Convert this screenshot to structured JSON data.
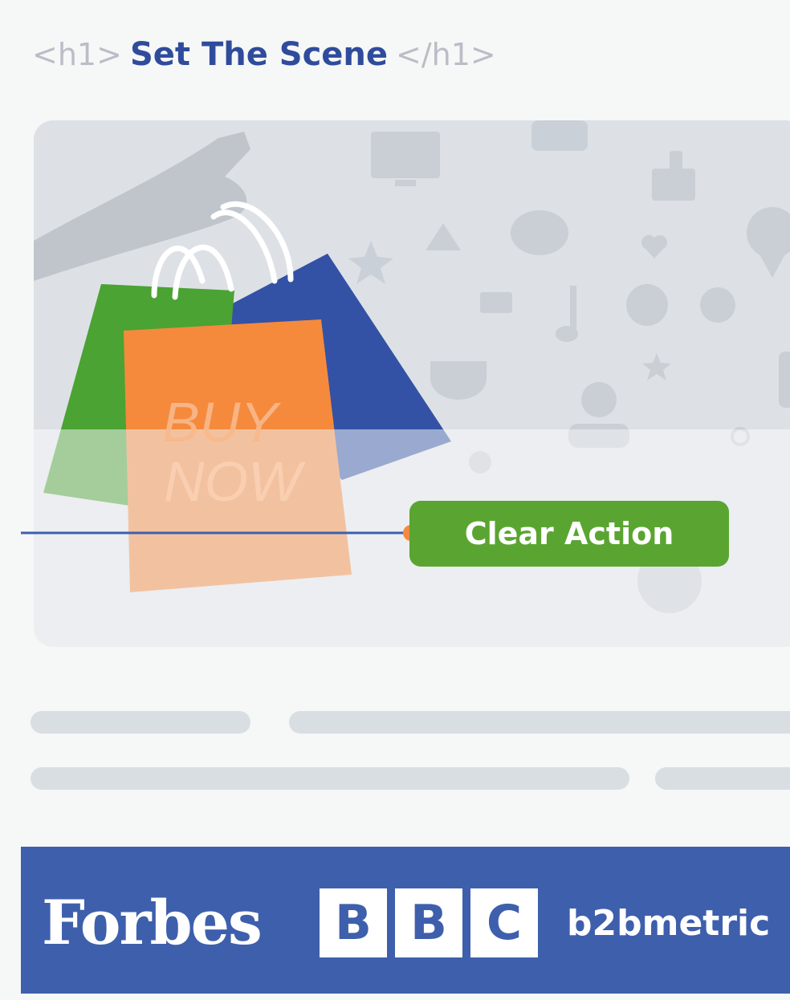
{
  "heading": {
    "open_tag": "<h1>",
    "title": "Set The Scene",
    "close_tag": "</h1>"
  },
  "hero": {
    "bag_text_line1": "BUY",
    "bag_text_line2": "NOW",
    "cta_label": "Clear Action",
    "background_icons": [
      "monitor-icon",
      "camera-icon",
      "thumbs-up-icon",
      "star-icon",
      "warning-icon",
      "chat-bubble-icon",
      "heart-icon",
      "map-pin-icon",
      "mail-icon",
      "music-note-icon",
      "plus-circle-icon",
      "gear-icon",
      "coffee-cup-icon",
      "user-icon",
      "globe-icon",
      "smiley-icon"
    ]
  },
  "logos": {
    "forbes": "Forbes",
    "bbc": [
      "B",
      "B",
      "C"
    ],
    "b2bmetric": "b2bmetric"
  },
  "colors": {
    "heading_blue": "#2f4c9c",
    "cta_green": "#5aa531",
    "bag_orange": "#f58a3c",
    "bag_green": "#4aa332",
    "bag_blue": "#3352a5",
    "logo_bar": "#3e5fac"
  }
}
